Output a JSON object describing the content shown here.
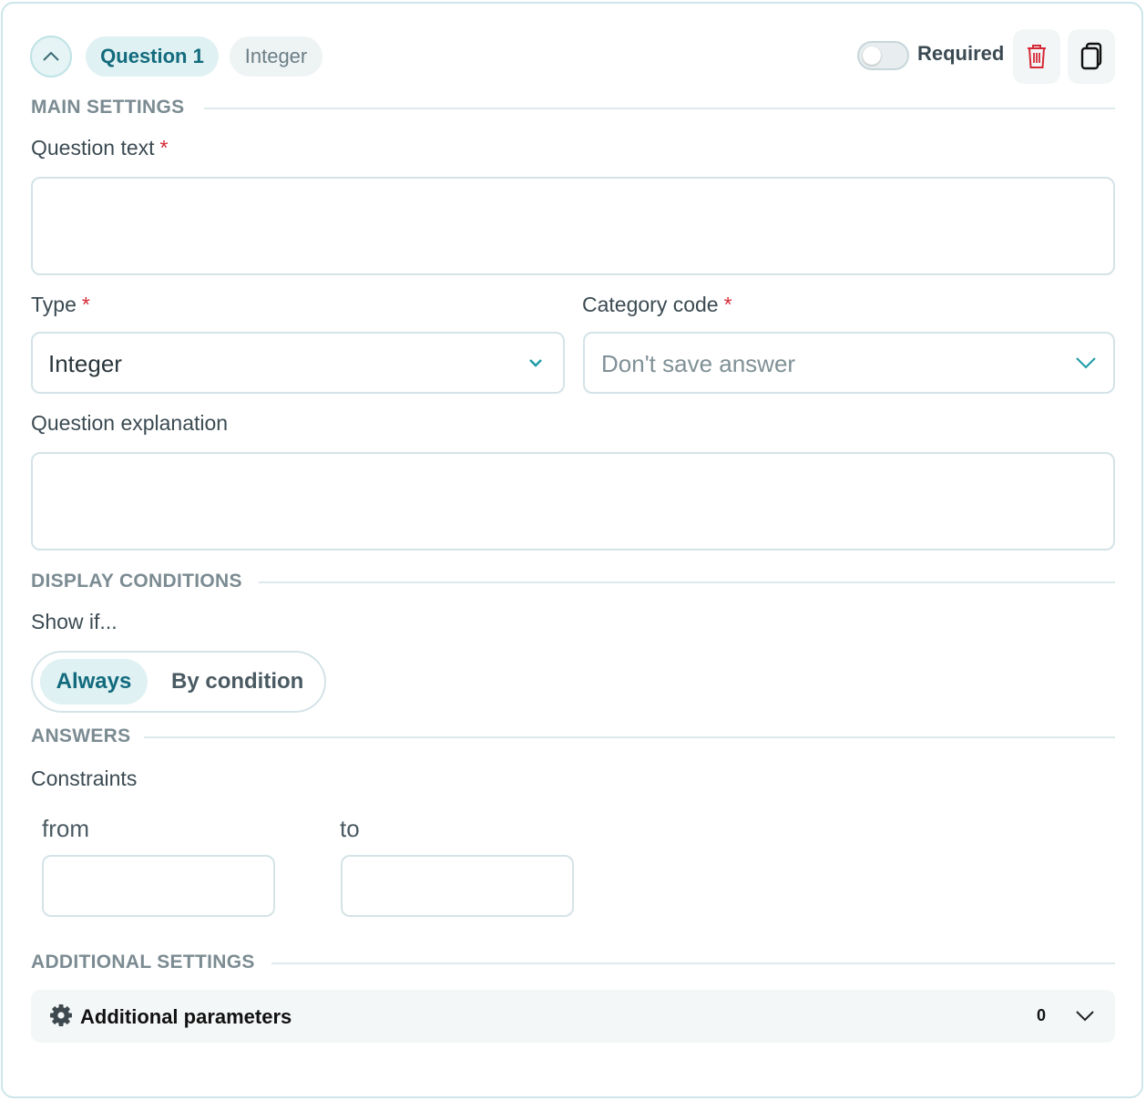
{
  "header": {
    "question_label": "Question 1",
    "type_badge": "Integer",
    "required_label": "Required",
    "required_on": false
  },
  "main_settings": {
    "section_title": "MAIN SETTINGS",
    "question_text_label": "Question text",
    "question_text_value": "",
    "type_label": "Type",
    "type_value": "Integer",
    "category_label": "Category code",
    "category_placeholder": "Don't save answer",
    "explanation_label": "Question explanation",
    "explanation_value": ""
  },
  "display_conditions": {
    "section_title": "DISPLAY CONDITIONS",
    "show_if_label": "Show if...",
    "options": [
      "Always",
      "By condition"
    ],
    "selected": "Always"
  },
  "answers": {
    "section_title": "ANSWERS",
    "constraints_label": "Constraints",
    "from_label": "from",
    "to_label": "to",
    "from_value": "",
    "to_value": ""
  },
  "additional": {
    "section_title": "ADDITIONAL SETTINGS",
    "params_label": "Additional parameters",
    "params_count": "0"
  },
  "colors": {
    "accent": "#126b7d",
    "required_star": "#d42a36",
    "delete_icon": "#d42a36"
  },
  "icons": [
    "chevron-up-icon",
    "trash-icon",
    "copy-icon",
    "chevron-down-icon",
    "gear-icon"
  ]
}
